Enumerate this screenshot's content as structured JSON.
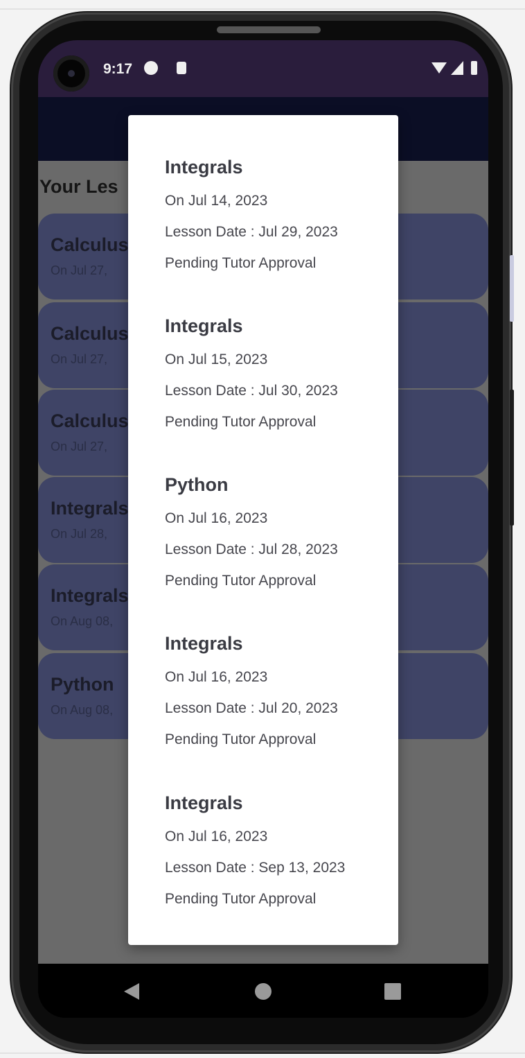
{
  "status_bar": {
    "time": "9:17"
  },
  "screen": {
    "section_title": "Your Les"
  },
  "background_cards": [
    {
      "title": "Calculus",
      "subtitle": "On Jul 27, "
    },
    {
      "title": "Calculus",
      "subtitle": "On Jul 27, "
    },
    {
      "title": "Calculus",
      "subtitle": "On Jul 27, "
    },
    {
      "title": "Integrals",
      "subtitle": "On Jul 28, "
    },
    {
      "title": "Integrals",
      "subtitle": "On Aug 08,"
    },
    {
      "title": "Python",
      "subtitle": "On Aug 08,"
    }
  ],
  "dialog": {
    "entries": [
      {
        "title": "Integrals",
        "on": "On Jul 14, 2023",
        "lesson_date": "Lesson Date : Jul 29, 2023",
        "status": "Pending Tutor Approval"
      },
      {
        "title": "Integrals",
        "on": "On Jul 15, 2023",
        "lesson_date": "Lesson Date : Jul 30, 2023",
        "status": "Pending Tutor Approval"
      },
      {
        "title": "Python",
        "on": "On Jul 16, 2023",
        "lesson_date": "Lesson Date : Jul 28, 2023",
        "status": "Pending Tutor Approval"
      },
      {
        "title": "Integrals",
        "on": "On Jul 16, 2023",
        "lesson_date": "Lesson Date : Jul 20, 2023",
        "status": "Pending Tutor Approval"
      },
      {
        "title": "Integrals",
        "on": "On Jul 16, 2023",
        "lesson_date": "Lesson Date : Sep 13, 2023",
        "status": "Pending Tutor Approval"
      }
    ]
  },
  "icons": {
    "status": [
      "camera-icon",
      "data-saver-icon",
      "sd-card-icon",
      "wifi-icon",
      "signal-icon",
      "battery-icon"
    ],
    "nav": [
      "back-icon",
      "home-icon",
      "recents-icon"
    ]
  },
  "colors": {
    "status_bar": "#2a1d3c",
    "app_bar": "#0b0e25",
    "card": "#3f4466",
    "scrim": "#6a6a6a",
    "dialog": "#ffffff"
  }
}
